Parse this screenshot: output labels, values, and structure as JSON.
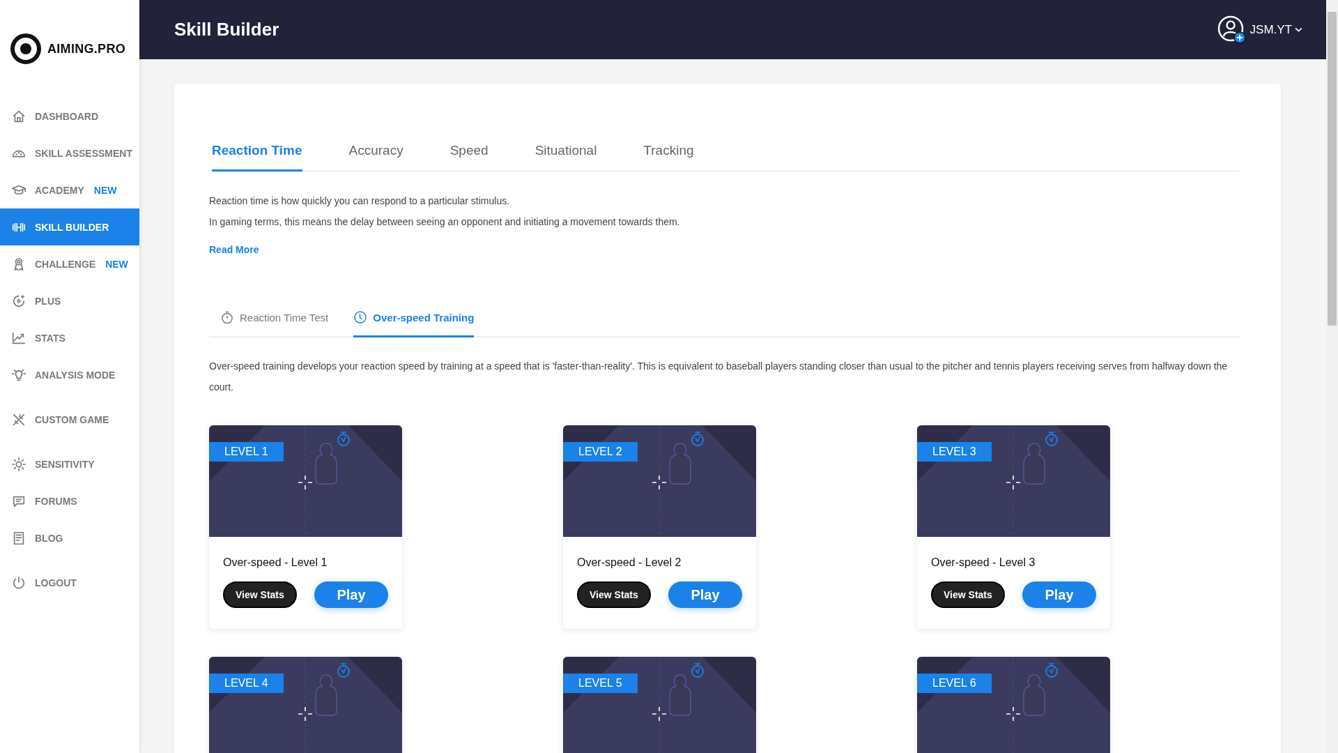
{
  "brand": {
    "name": "AIMING.PRO"
  },
  "sidebar": {
    "items": [
      {
        "label": "DASHBOARD",
        "selected": false
      },
      {
        "label": "SKILL ASSESSMENT",
        "selected": false
      },
      {
        "label": "ACADEMY",
        "badge": "NEW",
        "selected": false
      },
      {
        "label": "SKILL BUILDER",
        "selected": true
      },
      {
        "label": "CHALLENGE",
        "badge": "NEW",
        "selected": false
      },
      {
        "label": "PLUS",
        "selected": false
      },
      {
        "label": "STATS",
        "selected": false
      },
      {
        "label": "ANALYSIS MODE",
        "selected": false
      },
      {
        "label": "CUSTOM GAME",
        "selected": false
      },
      {
        "label": "SENSITIVITY",
        "selected": false
      },
      {
        "label": "FORUMS",
        "selected": false
      },
      {
        "label": "BLOG",
        "selected": false
      },
      {
        "label": "LOGOUT",
        "selected": false
      }
    ]
  },
  "header": {
    "title": "Skill Builder",
    "user": "JSM.YT"
  },
  "tabs": [
    {
      "label": "Reaction Time",
      "selected": true
    },
    {
      "label": "Accuracy",
      "selected": false
    },
    {
      "label": "Speed",
      "selected": false
    },
    {
      "label": "Situational",
      "selected": false
    },
    {
      "label": "Tracking",
      "selected": false
    }
  ],
  "description": [
    "Reaction time is how quickly you can respond to a particular stimulus.",
    "In gaming terms, this means the delay between seeing an opponent and initiating a movement towards them."
  ],
  "read_more": "Read More",
  "sub_tabs": [
    {
      "label": "Reaction Time Test",
      "selected": false
    },
    {
      "label": "Over-speed Training",
      "selected": true
    }
  ],
  "sub_description": "Over-speed training develops your reaction speed by training at a speed that is 'faster-than-reality'. This is equivalent to baseball players standing closer than usual to the pitcher and tennis players receiving serves from halfway down the court.",
  "cards": [
    {
      "level": "LEVEL 1",
      "title": "Over-speed - Level 1",
      "buttons": [
        "View Stats",
        "Play"
      ]
    },
    {
      "level": "LEVEL 2",
      "title": "Over-speed - Level 2",
      "buttons": [
        "View Stats",
        "Play"
      ]
    },
    {
      "level": "LEVEL 3",
      "title": "Over-speed - Level 3",
      "buttons": [
        "View Stats",
        "Play"
      ]
    },
    {
      "level": "LEVEL 4"
    },
    {
      "level": "LEVEL 5"
    },
    {
      "level": "LEVEL 6"
    }
  ]
}
